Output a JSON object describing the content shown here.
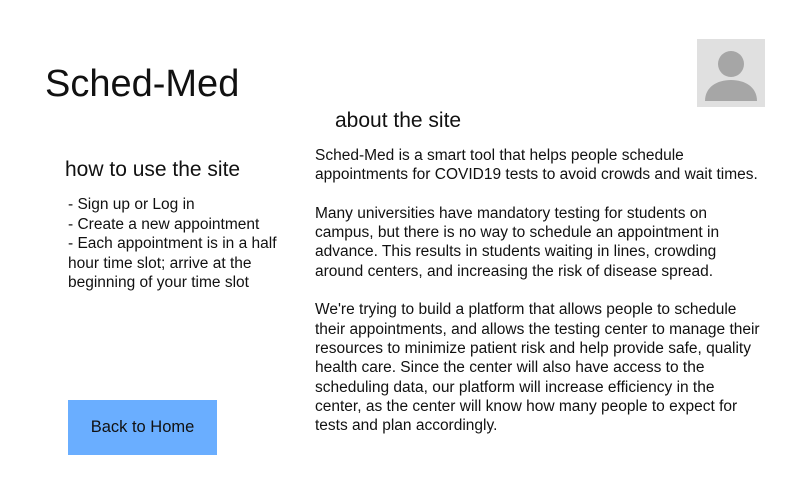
{
  "header": {
    "app_title": "Sched-Med",
    "avatar_icon": "user-avatar-icon"
  },
  "howto": {
    "heading": "how to use the site",
    "steps": [
      "- Sign up or Log in",
      "- Create a new appointment",
      "- Each appointment is in a half hour time slot; arrive at the beginning of your time slot"
    ]
  },
  "about": {
    "heading": "about the site",
    "paragraphs": [
      "Sched-Med is a smart tool that helps people schedule appointments for COVID19 tests to avoid crowds and wait times.",
      "Many universities have mandatory testing for students on campus, but there is no way to schedule an appointment in advance. This results in students waiting in lines, crowding around centers, and increasing the risk of disease spread.",
      "We're trying to build a platform that allows people to schedule their appointments, and allows the testing center to manage their resources to minimize patient risk and help provide safe, quality health care. Since the center will also have access to the scheduling data, our platform will increase efficiency in the center, as the center will know how many people to expect for tests and plan accordingly."
    ]
  },
  "actions": {
    "back_label": "Back to Home"
  },
  "colors": {
    "button_bg": "#6aaeff",
    "avatar_bg": "#e0e0e0",
    "avatar_fg": "#a6a6a6"
  }
}
